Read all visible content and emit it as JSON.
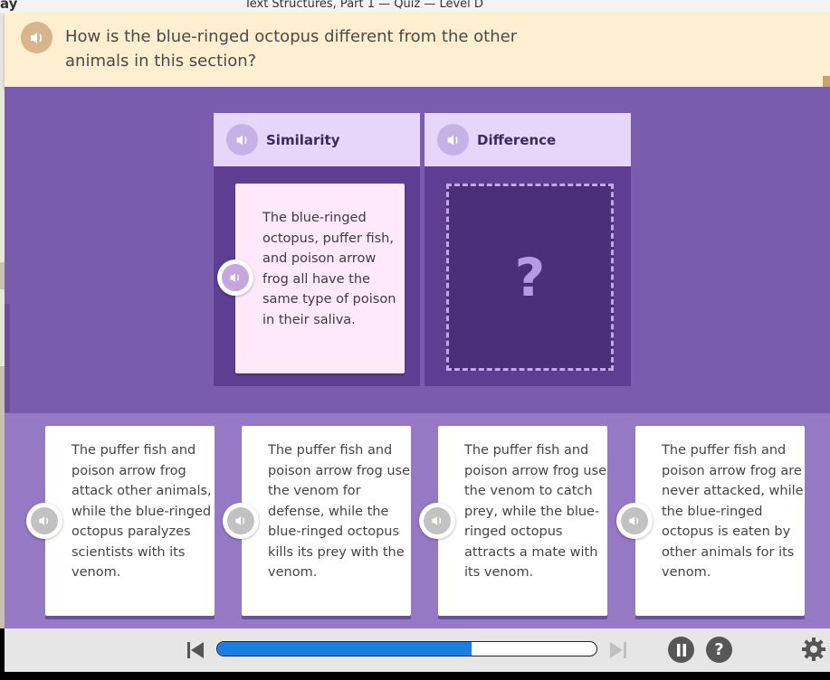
{
  "window": {
    "title": "Text Structures, Part 1 — Quiz — Level D",
    "left_fragment": "ay"
  },
  "question": {
    "text": "How is the blue-ringed octopus different from the other animals in this section?",
    "audio_icon": "speaker-icon"
  },
  "columns": [
    {
      "label": "Similarity",
      "card_text": "The blue-ringed octopus, puffer fish, and poison arrow frog all have the same type of poison in their saliva."
    },
    {
      "label": "Difference",
      "placeholder": "?"
    }
  ],
  "answers": [
    {
      "text": "The puffer fish and poison arrow frog attack other animals, while the blue-ringed octopus paralyzes scientists with its venom."
    },
    {
      "text": "The puffer fish and poison arrow frog use the venom for defense, while the blue-ringed octopus kills its prey with the venom."
    },
    {
      "text": "The puffer fish and poison arrow frog use the venom to catch prey, while the blue-ringed octopus attracts a mate with its venom."
    },
    {
      "text": "The puffer fish and poison arrow frog are never attacked, while the blue-ringed octopus is eaten by other animals for its venom."
    }
  ],
  "controls": {
    "progress_fraction": 0.67,
    "icons": [
      "skip-back-icon",
      "skip-forward-icon",
      "pause-icon",
      "help-icon",
      "settings-icon"
    ],
    "help_label": "?"
  },
  "colors": {
    "accent_blue": "#1b7fe0",
    "purple_bg": "#7d5fb1",
    "question_bg": "#fdefd0"
  }
}
